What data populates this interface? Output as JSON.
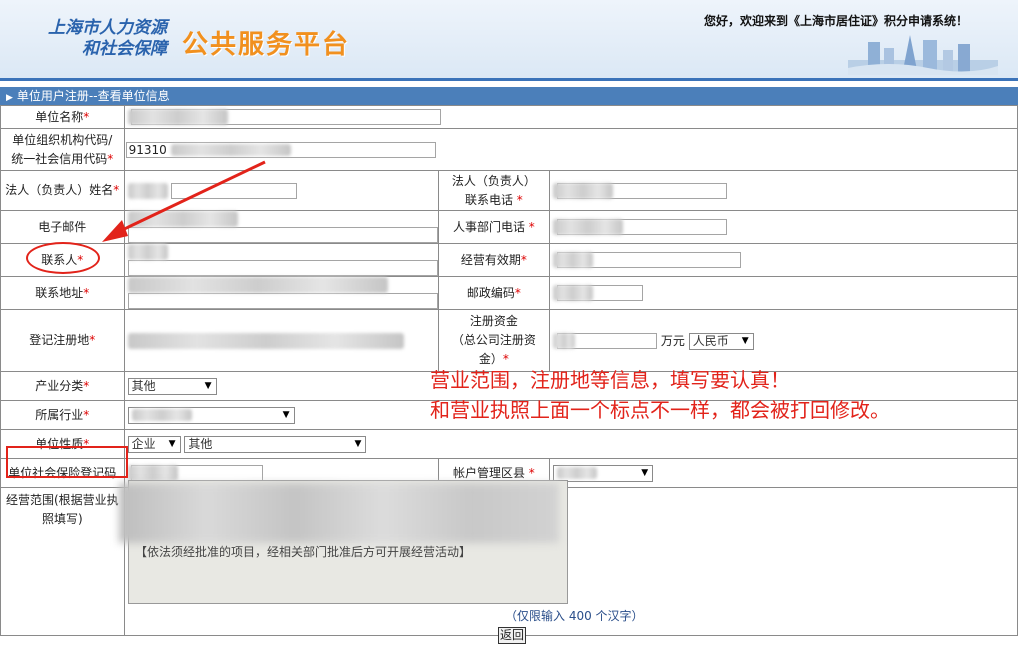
{
  "header": {
    "logo_line1": "上海市人力资源",
    "logo_line2": "和社会保障",
    "platform_title": "公共服务平台",
    "welcome": "您好，欢迎来到《上海市居住证》积分申请系统！"
  },
  "section": {
    "title": "单位用户注册--查看单位信息"
  },
  "form": {
    "req_mark": "*",
    "unit_name_label": "单位名称",
    "org_code_label_1": "单位组织机构代码/",
    "org_code_label_2": "统一社会信用代码",
    "org_code_value": "91310",
    "legal_name_label": "法人（负责人）姓名",
    "legal_phone_label_1": "法人（负责人）",
    "legal_phone_label_2": "联系电话",
    "email_label": "电子邮件",
    "hr_phone_label": "人事部门电话",
    "contact_label": "联系人",
    "validity_label": "经营有效期",
    "address_label": "联系地址",
    "postcode_label": "邮政编码",
    "reg_place_label": "登记注册地",
    "capital_label_1": "注册资金",
    "capital_label_2": "（总公司注册资",
    "capital_label_3": "金）",
    "capital_unit": "万元",
    "currency_value": "人民币",
    "industry_cat_label": "产业分类",
    "industry_cat_value": "其他",
    "industry_label": "所属行业",
    "nature_label": "单位性质",
    "nature_value1": "企业",
    "nature_value2": "其他",
    "social_code_label": "单位社会保险登记码",
    "district_label": "帐户管理区县",
    "scope_label_1": "经营范围(根据营业执",
    "scope_label_2": "照填写)",
    "scope_text": "【依法须经批准的项目，经相关部门批准后方可开展经营活动】",
    "hint": "（仅限输入 400 个汉字）",
    "back_button": "返回"
  },
  "annotation": {
    "line1": "营业范围，注册地等信息，填写要认真！",
    "line2": "和营业执照上面一个标点不一样，都会被打回修改。"
  }
}
